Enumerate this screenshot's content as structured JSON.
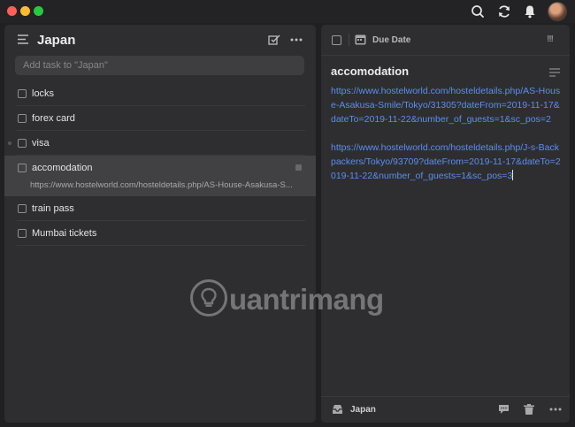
{
  "window": {
    "traffic_lights": {
      "close": "#fe5f57",
      "minimize": "#febc2e",
      "zoom": "#28c840"
    },
    "toolbar_icons": [
      "search-icon",
      "sync-icon",
      "notification-bell-icon",
      "user-avatar"
    ]
  },
  "list": {
    "title": "Japan",
    "add_task_placeholder": "Add task to \"Japan\"",
    "tasks": [
      {
        "label": "locks"
      },
      {
        "label": "forex card"
      },
      {
        "label": "visa"
      },
      {
        "label": "accomodation",
        "note_preview": "https://www.hostelworld.com/hosteldetails.php/AS-House-Asakusa-S...",
        "selected": true
      },
      {
        "label": "train pass"
      },
      {
        "label": "Mumbai tickets"
      }
    ]
  },
  "detail": {
    "due_date_label": "Due Date",
    "priority_label": "!!!",
    "title": "accomodation",
    "note_paragraphs": [
      "https://www.hostelworld.com/hosteldetails.php/AS-House-Asakusa-Smile/Tokyo/31305?dateFrom=2019-11-17&dateTo=2019-11-22&number_of_guests=1&sc_pos=2",
      "https://www.hostelworld.com/hosteldetails.php/J-s-Backpackers/Tokyo/93709?dateFrom=2019-11-17&dateTo=2019-11-22&number_of_guests=1&sc_pos=3"
    ],
    "link_color": "#5b8ef0",
    "footer_list": "Japan"
  },
  "watermark": {
    "text": "uantrimang"
  }
}
